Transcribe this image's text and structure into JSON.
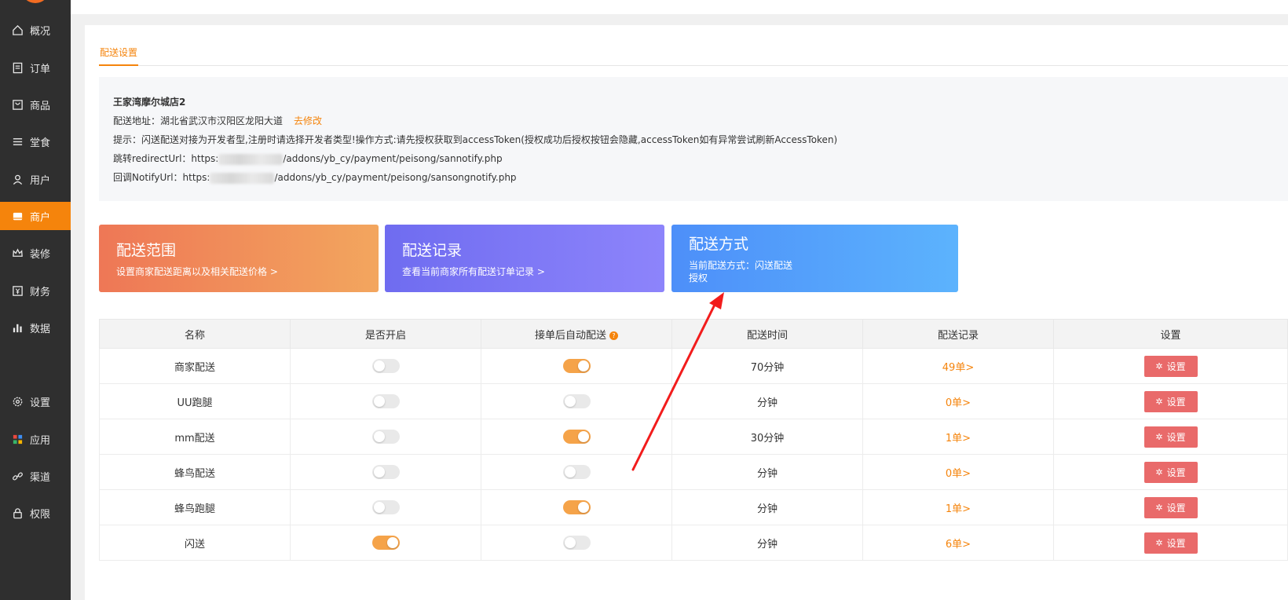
{
  "sidebar": {
    "items": [
      {
        "label": "概况",
        "icon": "home-icon"
      },
      {
        "label": "订单",
        "icon": "order-icon"
      },
      {
        "label": "商品",
        "icon": "goods-icon"
      },
      {
        "label": "堂食",
        "icon": "menu-icon"
      },
      {
        "label": "用户",
        "icon": "user-icon"
      },
      {
        "label": "商户",
        "icon": "store-icon",
        "active": true
      },
      {
        "label": "装修",
        "icon": "crown-icon"
      },
      {
        "label": "财务",
        "icon": "finance-icon"
      },
      {
        "label": "数据",
        "icon": "chart-icon"
      },
      {
        "label": "设置",
        "icon": "gear-icon"
      },
      {
        "label": "应用",
        "icon": "apps-icon"
      },
      {
        "label": "渠道",
        "icon": "link-icon"
      },
      {
        "label": "权限",
        "icon": "lock-icon"
      }
    ]
  },
  "tabs": {
    "active": "配送设置"
  },
  "info": {
    "store_name": "王家湾摩尔城店2",
    "address_label": "配送地址：湖北省武汉市汉阳区龙阳大道",
    "edit_link": "去修改",
    "tip": "提示：闪送配送对接为开发者型,注册时请选择开发者类型!操作方式:请先授权获取到accessToken(授权成功后授权按钮会隐藏,accessToken如有异常尝试刷新AccessToken)",
    "redirect_prefix": "跳转redirectUrl：https:",
    "redirect_suffix": "/addons/yb_cy/payment/peisong/sannotify.php",
    "notify_prefix": "回调NotifyUrl：https:",
    "notify_suffix": "/addons/yb_cy/payment/peisong/sansongnotify.php"
  },
  "cards": {
    "range": {
      "title": "配送范围",
      "sub": "设置商家配送距离以及相关配送价格 >"
    },
    "records": {
      "title": "配送记录",
      "sub": "查看当前商家所有配送订单记录 >"
    },
    "method": {
      "title": "配送方式",
      "sub": "当前配送方式：闪送配送",
      "auth": "授权"
    }
  },
  "table": {
    "headers": [
      "名称",
      "是否开启",
      "接单后自动配送",
      "配送时间",
      "配送记录",
      "设置"
    ],
    "help_icon": "?",
    "button_label": "设置",
    "rows": [
      {
        "name": "商家配送",
        "enabled": false,
        "auto": true,
        "time": "70分钟",
        "records": "49单>"
      },
      {
        "name": "UU跑腿",
        "enabled": false,
        "auto": false,
        "time": "分钟",
        "records": "0单>"
      },
      {
        "name": "mm配送",
        "enabled": false,
        "auto": true,
        "time": "30分钟",
        "records": "1单>"
      },
      {
        "name": "蜂鸟配送",
        "enabled": false,
        "auto": false,
        "time": "分钟",
        "records": "0单>"
      },
      {
        "name": "蜂鸟跑腿",
        "enabled": false,
        "auto": true,
        "time": "分钟",
        "records": "1单>"
      },
      {
        "name": "闪送",
        "enabled": true,
        "auto": false,
        "time": "分钟",
        "records": "6单>"
      }
    ]
  },
  "colors": {
    "accent": "#f5840c",
    "sidebar": "#2f2f2f",
    "danger_button": "#e96a6a",
    "annotation_arrow": "#f21c1c"
  }
}
